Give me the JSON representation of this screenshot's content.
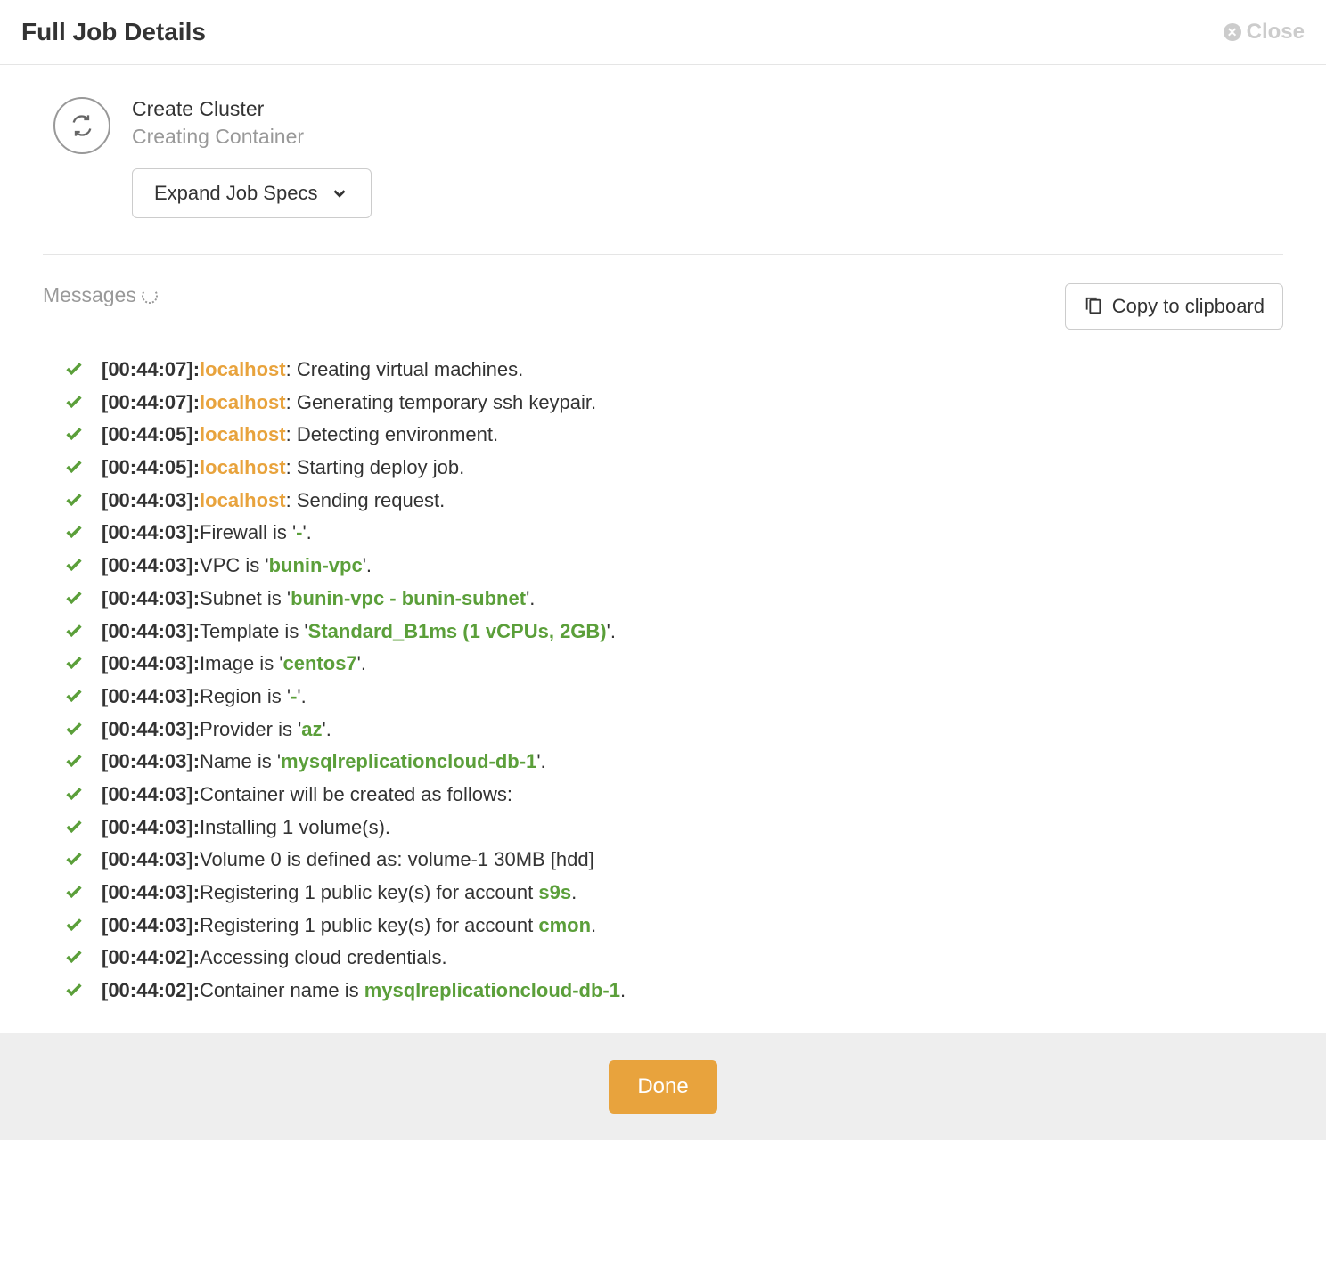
{
  "header": {
    "title": "Full Job Details",
    "close_label": "Close"
  },
  "job": {
    "title": "Create Cluster",
    "subtitle": "Creating Container",
    "expand_label": "Expand Job Specs"
  },
  "messages_section": {
    "label": "Messages",
    "copy_label": "Copy to clipboard"
  },
  "messages": [
    {
      "ts": "[00:44:07]:",
      "host": "localhost",
      "prefix": ": ",
      "text": "Creating virtual machines."
    },
    {
      "ts": "[00:44:07]:",
      "host": "localhost",
      "prefix": ": ",
      "text": "Generating temporary ssh keypair."
    },
    {
      "ts": "[00:44:05]:",
      "host": "localhost",
      "prefix": ": ",
      "text": "Detecting environment."
    },
    {
      "ts": "[00:44:05]:",
      "host": "localhost",
      "prefix": ": ",
      "text": "Starting deploy job."
    },
    {
      "ts": "[00:44:03]:",
      "host": "localhost",
      "prefix": ": ",
      "text": "Sending request."
    },
    {
      "ts": "[00:44:03]:",
      "text_pre": "Firewall is '",
      "val": "-",
      "text_post": "'."
    },
    {
      "ts": "[00:44:03]:",
      "text_pre": "VPC is '",
      "val": "bunin-vpc",
      "text_post": "'."
    },
    {
      "ts": "[00:44:03]:",
      "text_pre": "Subnet is '",
      "val": "bunin-vpc - bunin-subnet",
      "text_post": "'."
    },
    {
      "ts": "[00:44:03]:",
      "text_pre": "Template is '",
      "val": "Standard_B1ms (1 vCPUs, 2GB)",
      "text_post": "'."
    },
    {
      "ts": "[00:44:03]:",
      "text_pre": "Image is '",
      "val": "centos7",
      "text_post": "'."
    },
    {
      "ts": "[00:44:03]:",
      "text_pre": "Region is '",
      "val": "-",
      "text_post": "'."
    },
    {
      "ts": "[00:44:03]:",
      "text_pre": "Provider is '",
      "val": "az",
      "text_post": "'."
    },
    {
      "ts": "[00:44:03]:",
      "text_pre": "Name is '",
      "val": "mysqlreplicationcloud-db-1",
      "text_post": "'."
    },
    {
      "ts": "[00:44:03]:",
      "text": "Container will be created as follows:"
    },
    {
      "ts": "[00:44:03]:",
      "text": "Installing 1 volume(s)."
    },
    {
      "ts": "[00:44:03]:",
      "text": "Volume 0 is defined as: volume-1 30MB [hdd]"
    },
    {
      "ts": "[00:44:03]:",
      "text_pre": "Registering 1 public key(s) for account ",
      "val": "s9s",
      "text_post": "."
    },
    {
      "ts": "[00:44:03]:",
      "text_pre": "Registering 1 public key(s) for account ",
      "val": "cmon",
      "text_post": "."
    },
    {
      "ts": "[00:44:02]:",
      "text": "Accessing cloud credentials."
    },
    {
      "ts": "[00:44:02]:",
      "text_pre": "Container name is ",
      "val": "mysqlreplicationcloud-db-1",
      "text_post": "."
    }
  ],
  "footer": {
    "done_label": "Done"
  }
}
